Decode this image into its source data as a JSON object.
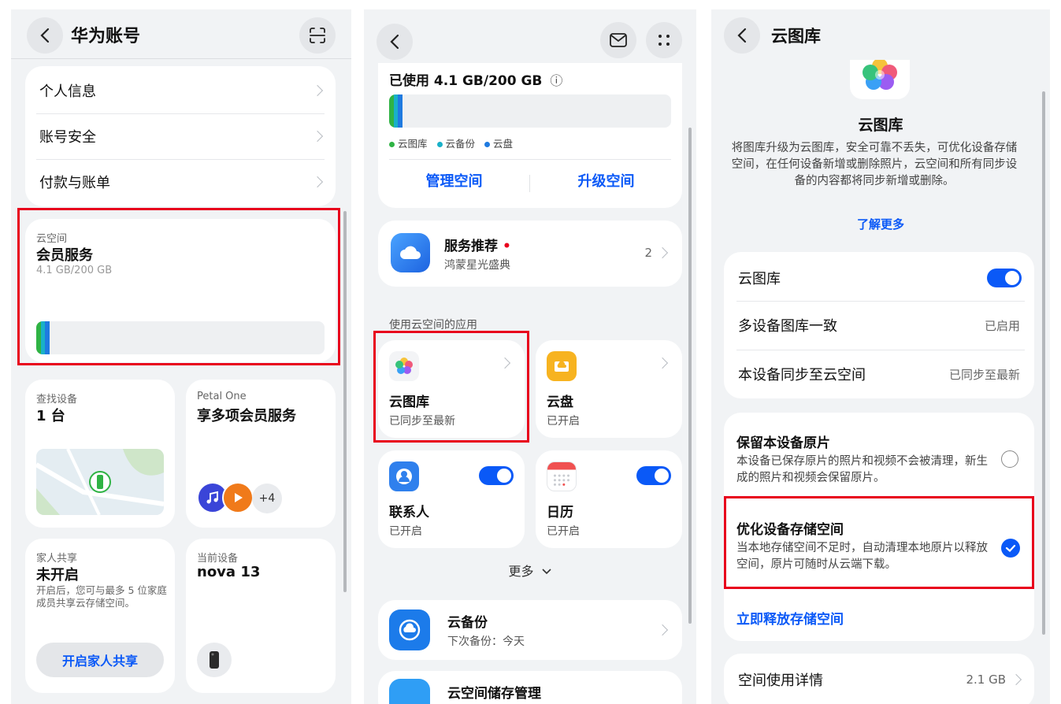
{
  "panel1": {
    "title": "华为账号",
    "menu": [
      {
        "label": "个人信息"
      },
      {
        "label": "账号安全"
      },
      {
        "label": "付款与账单"
      }
    ],
    "cloud": {
      "caption": "云空间",
      "title": "会员服务",
      "usage": "4.1 GB/200 GB"
    },
    "find_device": {
      "caption": "查找设备",
      "value": "1 台"
    },
    "petal": {
      "caption": "Petal One",
      "value": "享多项会员服务",
      "more": "+4"
    },
    "family": {
      "caption": "家人共享",
      "value": "未开启",
      "desc": "开启后，您可与最多 5 位家庭成员共享云存储空间。",
      "button": "开启家人共享"
    },
    "current_device": {
      "caption": "当前设备",
      "value": "nova 13"
    }
  },
  "panel2": {
    "usage_title": "已使用 4.1 GB/200 GB",
    "info_icon": "ⓘ",
    "legend": [
      {
        "label": "云图库",
        "color": "#2fb344"
      },
      {
        "label": "云备份",
        "color": "#19b0c8"
      },
      {
        "label": "云盘",
        "color": "#1f7ae0"
      }
    ],
    "manage_label": "管理空间",
    "upgrade_label": "升级空间",
    "service": {
      "title": "服务推荐",
      "subtitle": "鸿蒙星光盛典",
      "count": "2"
    },
    "apps_section": "使用云空间的应用",
    "apps": [
      {
        "name": "云图库",
        "status": "已同步至最新"
      },
      {
        "name": "云盘",
        "status": "已开启"
      },
      {
        "name": "联系人",
        "status": "已开启"
      },
      {
        "name": "日历",
        "status": "已开启"
      }
    ],
    "more_label": "更多",
    "backup": {
      "title": "云备份",
      "subtitle": "下次备份：今天"
    },
    "bottom_partial": "云空间储存管理"
  },
  "panel3": {
    "title": "云图库",
    "hero_title": "云图库",
    "hero_desc": "将图库升级为云图库，安全可靠不丢失，可优化设备存储空间，在任何设备新增或删除照片，云空间和所有同步设备的内容都将同步新增或删除。",
    "learn_more": "了解更多",
    "settings": [
      {
        "label": "云图库",
        "value": ""
      },
      {
        "label": "多设备图库一致",
        "value": "已启用"
      },
      {
        "label": "本设备同步至云空间",
        "value": "已同步至最新"
      }
    ],
    "keep_original": {
      "title": "保留本设备原片",
      "desc": "本设备已保存原片的照片和视频不会被清理，新生成的照片和视频会保留原片。"
    },
    "optimize": {
      "title": "优化设备存储空间",
      "desc": "当本地存储空间不足时，自动清理本地原片以释放空间，原片可随时从云端下载。"
    },
    "free_now": "立即释放存储空间",
    "space_detail": {
      "label": "空间使用详情",
      "value": "2.1 GB"
    }
  },
  "colors": {
    "accent": "#0a59f7",
    "highlight": "#e8001c"
  }
}
